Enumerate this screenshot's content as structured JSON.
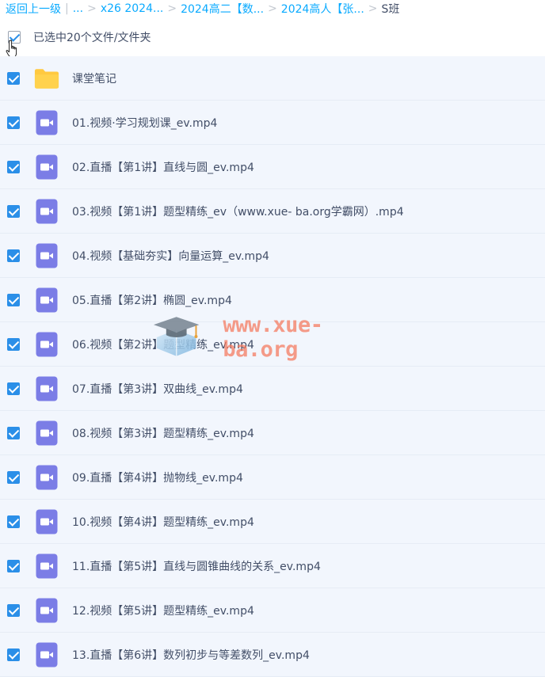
{
  "breadcrumb": {
    "back_label": "返回上一级",
    "items": [
      "...",
      "x26 2024...",
      "2024高二【数...",
      "2024高人【张..."
    ],
    "current": "S班"
  },
  "selection": {
    "summary": "已选中20个文件/文件夹"
  },
  "files": [
    {
      "name": "课堂笔记",
      "type": "folder"
    },
    {
      "name": "01.视频·学习规划课_ev.mp4",
      "type": "video"
    },
    {
      "name": "02.直播【第1讲】直线与圆_ev.mp4",
      "type": "video"
    },
    {
      "name": "03.视频【第1讲】题型精练_ev（www.xue- ba.org学霸网）.mp4",
      "type": "video"
    },
    {
      "name": "04.视频【基础夯实】向量运算_ev.mp4",
      "type": "video"
    },
    {
      "name": "05.直播【第2讲】椭圆_ev.mp4",
      "type": "video"
    },
    {
      "name": "06.视频【第2讲】题型精练_ev.mp4",
      "type": "video"
    },
    {
      "name": "07.直播【第3讲】双曲线_ev.mp4",
      "type": "video"
    },
    {
      "name": "08.视频【第3讲】题型精练_ev.mp4",
      "type": "video"
    },
    {
      "name": "09.直播【第4讲】抛物线_ev.mp4",
      "type": "video"
    },
    {
      "name": "10.视频【第4讲】题型精练_ev.mp4",
      "type": "video"
    },
    {
      "name": "11.直播【第5讲】直线与圆锥曲线的关系_ev.mp4",
      "type": "video"
    },
    {
      "name": "12.视频【第5讲】题型精练_ev.mp4",
      "type": "video"
    },
    {
      "name": "13.直播【第6讲】数列初步与等差数列_ev.mp4",
      "type": "video"
    }
  ],
  "watermark": {
    "text": "www.xue-ba.org"
  },
  "colors": {
    "link": "#09aaff",
    "checkbox": "#2b8fe8",
    "video_icon": "#7b7de6",
    "folder_icon": "#ffc940",
    "row_bg": "#f2f6fd"
  }
}
